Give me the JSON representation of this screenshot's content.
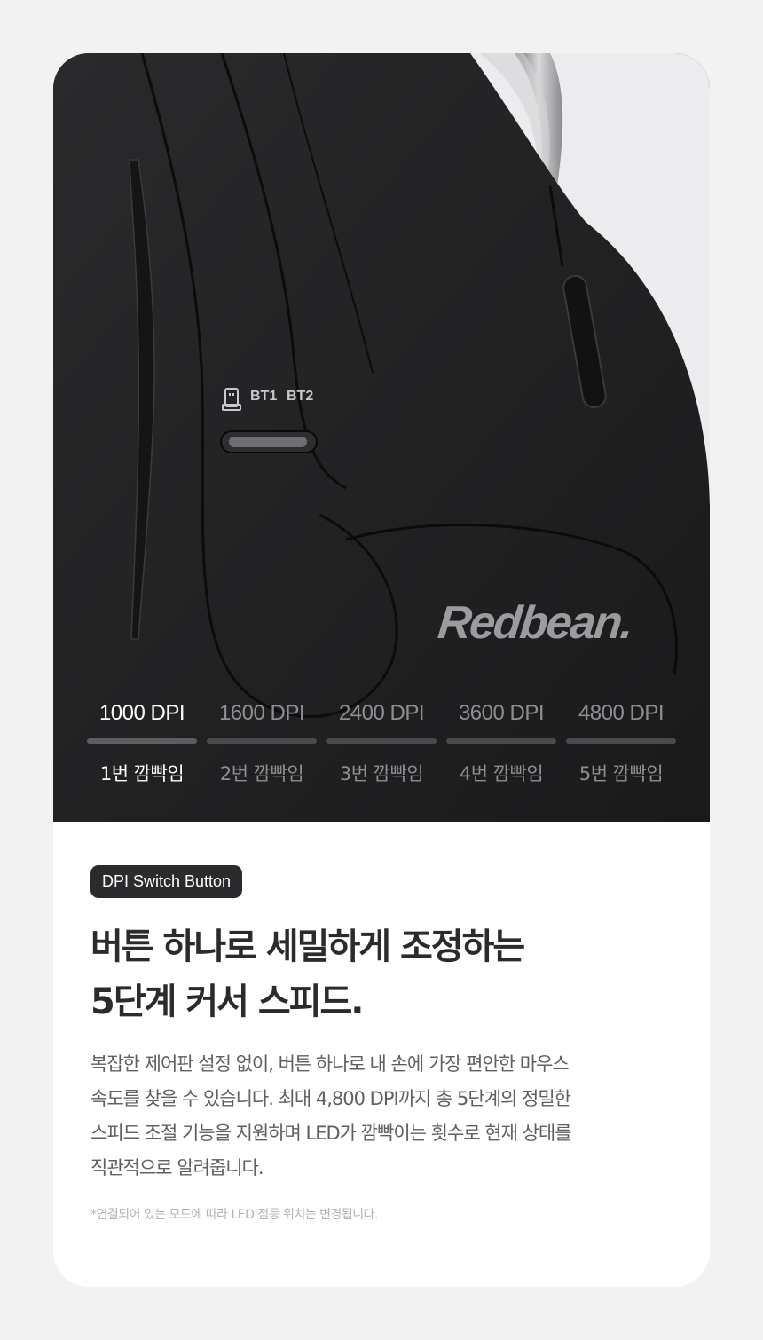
{
  "hero": {
    "brand": "Redbean.",
    "bt1_label": "BT1",
    "bt2_label": "BT2",
    "dpi_levels": [
      {
        "dpi": "1000 DPI",
        "blink": "1번 깜빡임",
        "active": true
      },
      {
        "dpi": "1600 DPI",
        "blink": "2번 깜빡임",
        "active": false
      },
      {
        "dpi": "2400 DPI",
        "blink": "3번 깜빡임",
        "active": false
      },
      {
        "dpi": "3600 DPI",
        "blink": "4번 깜빡임",
        "active": false
      },
      {
        "dpi": "4800 DPI",
        "blink": "5번 깜빡임",
        "active": false
      }
    ]
  },
  "content": {
    "badge": "DPI Switch Button",
    "headline": [
      "버튼 하나로 세밀하게 조정하는",
      "5단계 커서 스피드."
    ],
    "body": [
      "복잡한 제어판 설정 없이, 버튼 하나로 내 손에 가장 편안한 마우스",
      "속도를 찾을 수 있습니다. 최대 4,800 DPI까지 총 5단계의 정밀한",
      "스피드 조절 기능을 지원하며 LED가 깜빡이는 횟수로 현재 상태를",
      "직관적으로 알려줍니다."
    ],
    "footnote": "*연결되어 있는 모드에 따라 LED 점등 위치는 변경됩니다."
  },
  "colors": {
    "background": "#f2f2f3",
    "card": "#ffffff",
    "badge_bg": "#2b2b2e",
    "headline": "#2b2b2e",
    "body": "#5f5f63",
    "footnote": "#b3b3b7",
    "dpi_active": "#ffffff",
    "dpi_inactive": "#8e8f93"
  }
}
